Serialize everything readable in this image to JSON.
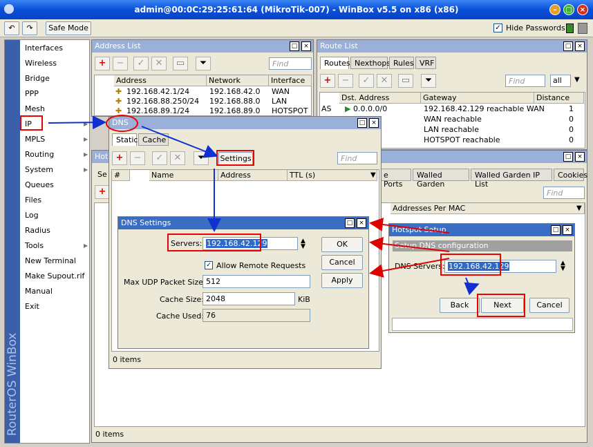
{
  "app": {
    "title": "admin@00:0C:29:25:61:64 (MikroTik-007) - WinBox v5.5 on x86 (x86)",
    "brand_vertical": "RouterOS WinBox",
    "safe_mode_label": "Safe Mode",
    "hide_passwords_label": "Hide Passwords"
  },
  "sidebar": {
    "items": [
      {
        "label": "Interfaces",
        "submenu": false
      },
      {
        "label": "Wireless",
        "submenu": false
      },
      {
        "label": "Bridge",
        "submenu": false
      },
      {
        "label": "PPP",
        "submenu": false
      },
      {
        "label": "Mesh",
        "submenu": false
      },
      {
        "label": "IP",
        "submenu": true
      },
      {
        "label": "MPLS",
        "submenu": true
      },
      {
        "label": "Routing",
        "submenu": true
      },
      {
        "label": "System",
        "submenu": true
      },
      {
        "label": "Queues",
        "submenu": false
      },
      {
        "label": "Files",
        "submenu": false
      },
      {
        "label": "Log",
        "submenu": false
      },
      {
        "label": "Radius",
        "submenu": false
      },
      {
        "label": "Tools",
        "submenu": true
      },
      {
        "label": "New Terminal",
        "submenu": false
      },
      {
        "label": "Make Supout.rif",
        "submenu": false
      },
      {
        "label": "Manual",
        "submenu": false
      },
      {
        "label": "Exit",
        "submenu": false
      }
    ]
  },
  "address_list": {
    "title": "Address List",
    "find_placeholder": "Find",
    "columns": [
      "Address",
      "Network",
      "Interface"
    ],
    "rows": [
      [
        "192.168.42.1/24",
        "192.168.42.0",
        "WAN"
      ],
      [
        "192.168.88.250/24",
        "192.168.88.0",
        "LAN"
      ],
      [
        "192.168.89.1/24",
        "192.168.89.0",
        "HOTSPOT"
      ]
    ]
  },
  "route_list": {
    "title": "Route List",
    "tabs": [
      "Routes",
      "Nexthops",
      "Rules",
      "VRF"
    ],
    "find_placeholder": "Find",
    "filter_value": "all",
    "columns": [
      "Dst. Address",
      "Gateway",
      "Distance"
    ],
    "rows": [
      [
        "AS",
        "0.0.0.0/0",
        "192.168.42.129 reachable WAN",
        "1"
      ],
      [
        "",
        "2.0/24",
        "WAN reachable",
        "0"
      ],
      [
        "",
        "8.0/24",
        "LAN reachable",
        "0"
      ],
      [
        "",
        "9.0/24",
        "HOTSPOT reachable",
        "0"
      ]
    ]
  },
  "hotspot_window": {
    "title_partial": "Hots",
    "tab_partial": "Se",
    "tabs": [
      "e Ports",
      "Walled Garden",
      "Walled Garden IP List",
      "Cookies"
    ],
    "find_placeholder": "Find",
    "column": "Addresses Per MAC",
    "status": "0 items"
  },
  "dns_window": {
    "title": "DNS",
    "tabs": [
      "Static",
      "Cache"
    ],
    "settings_button": "Settings",
    "find_placeholder": "Find",
    "columns": [
      "#",
      "Name",
      "Address",
      "TTL (s)"
    ],
    "status": "0 items"
  },
  "dns_settings": {
    "title": "DNS Settings",
    "servers_label": "Servers:",
    "servers_value": "192.168.42.129",
    "allow_remote_label": "Allow Remote Requests",
    "allow_remote_checked": true,
    "max_udp_label": "Max UDP Packet Size:",
    "max_udp_value": "512",
    "cache_size_label": "Cache Size:",
    "cache_size_value": "2048",
    "cache_size_unit": "KiB",
    "cache_used_label": "Cache Used:",
    "cache_used_value": "76",
    "ok_label": "OK",
    "cancel_label": "Cancel",
    "apply_label": "Apply"
  },
  "hotspot_setup": {
    "title": "Hotspot Setup",
    "subtitle": "Setup DNS configuration",
    "dns_servers_label": "DNS Servers:",
    "dns_servers_value": "192.168.42.129",
    "back_label": "Back",
    "next_label": "Next",
    "cancel_label": "Cancel"
  },
  "colors": {
    "annotation_red": "#e00000",
    "annotation_blue": "#1030d0",
    "selection_blue": "#316ac5"
  }
}
